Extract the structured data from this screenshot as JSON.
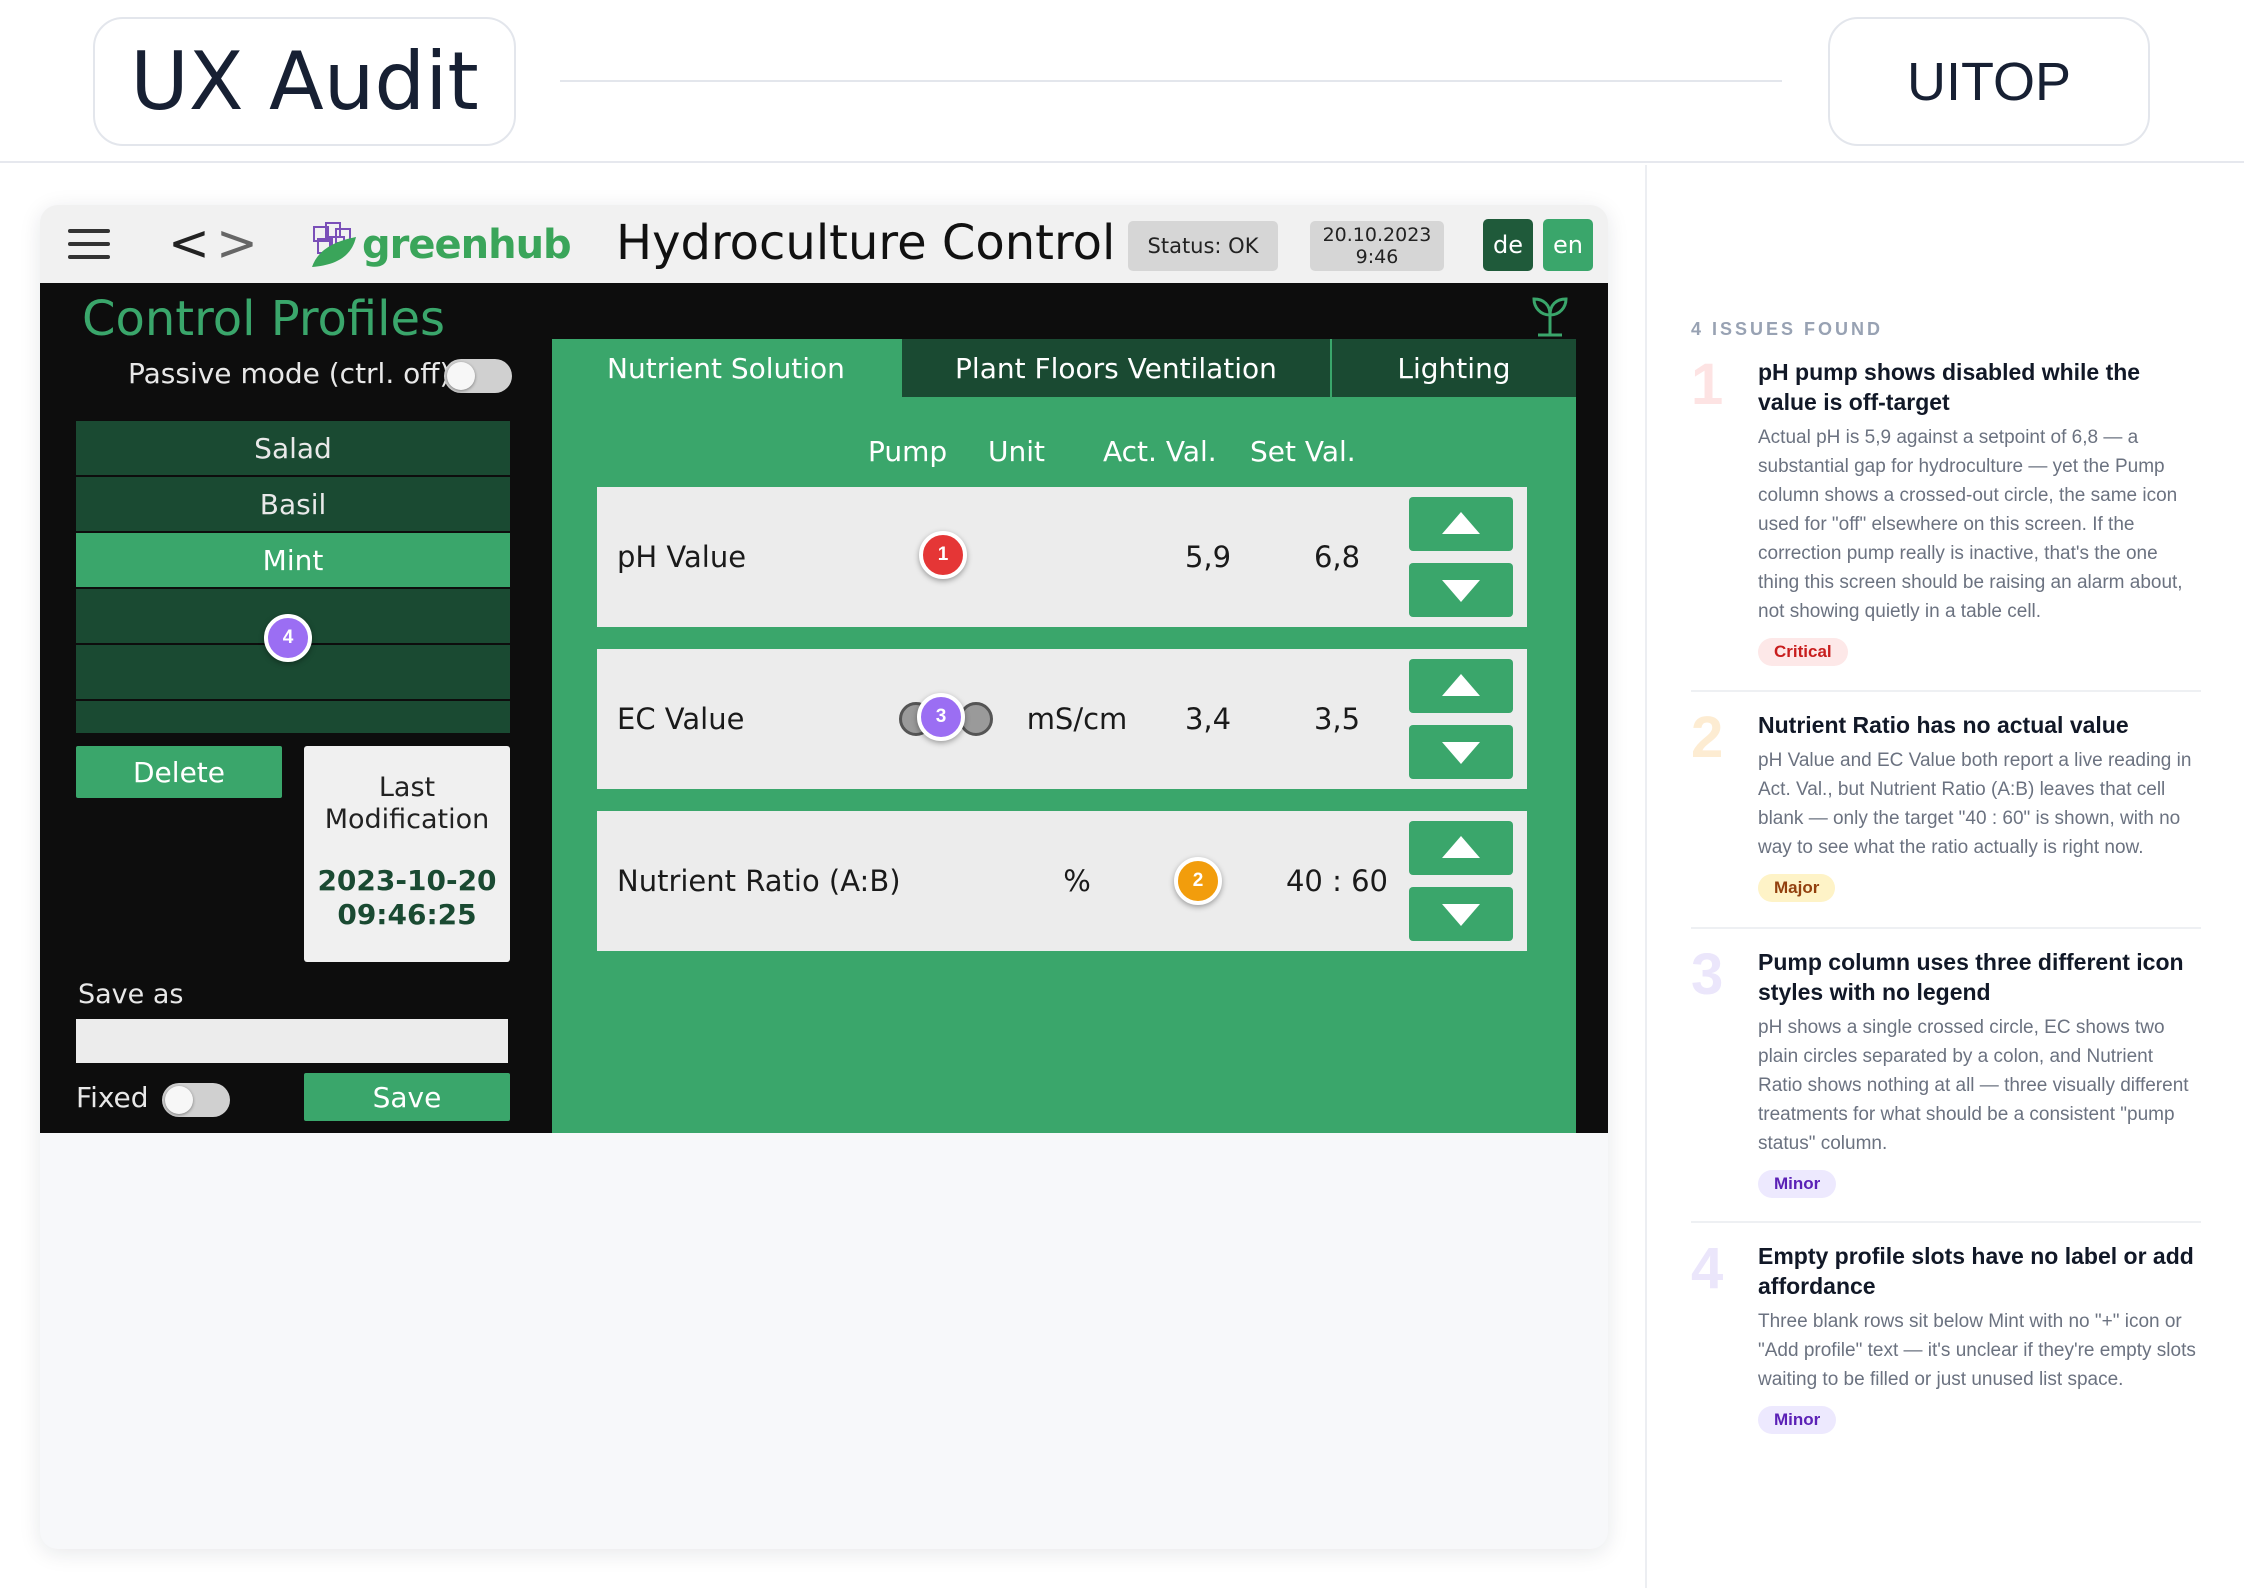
{
  "header": {
    "title": "UX Audit",
    "brand": "UITOP"
  },
  "app": {
    "brand_name": "greenhub",
    "title": "Hydroculture Control",
    "status": "Status: OK",
    "date": "20.10.2023",
    "time": "9:46",
    "lang_de": "de",
    "lang_en": "en",
    "accent_color": "#3aa66b",
    "dark_green": "#1a4a32"
  },
  "profiles": {
    "title": "Control Profiles",
    "passive_label": "Passive mode (ctrl. off)",
    "items": [
      "Salad",
      "Basil",
      "Mint",
      "",
      "",
      ""
    ],
    "active_index": 2,
    "delete_label": "Delete",
    "last_mod_label": "Last Modification",
    "last_mod_date": "2023-10-20",
    "last_mod_time": "09:46:25",
    "save_as_label": "Save as",
    "save_as_value": "",
    "fixed_label": "Fixed",
    "save_label": "Save"
  },
  "tabs": [
    "Nutrient Solution",
    "Plant Floors Ventilation",
    "Lighting"
  ],
  "table": {
    "columns": [
      "Pump",
      "Unit",
      "Act. Val.",
      "Set Val."
    ],
    "rows": [
      {
        "label": "pH Value",
        "unit": "",
        "act": "5,9",
        "set": "6,8"
      },
      {
        "label": "EC Value",
        "unit": "mS/cm",
        "act": "3,4",
        "set": "3,5"
      },
      {
        "label": "Nutrient Ratio (A:B)",
        "unit": "%",
        "act": "",
        "set": "40 : 60"
      }
    ]
  },
  "markers": [
    "1",
    "2",
    "3",
    "4"
  ],
  "sidebar": {
    "count_label": "4 ISSUES FOUND",
    "issues": [
      {
        "number": "1",
        "title": "pH pump shows disabled while the value is off-target",
        "description": "Actual pH is 5,9 against a setpoint of 6,8 — a substantial gap for hydroculture — yet the Pump column shows a crossed-out circle, the same icon used for \"off\" elsewhere on this screen. If the correction pump really is inactive, that's the one thing this screen should be raising an alarm about, not showing quietly in a table cell.",
        "severity": "Critical"
      },
      {
        "number": "2",
        "title": "Nutrient Ratio has no actual value",
        "description": "pH Value and EC Value both report a live reading in Act. Val., but Nutrient Ratio (A:B) leaves that cell blank — only the target \"40 : 60\" is shown, with no way to see what the ratio actually is right now.",
        "severity": "Major"
      },
      {
        "number": "3",
        "title": "Pump column uses three different icon styles with no legend",
        "description": "pH shows a single crossed circle, EC shows two plain circles separated by a colon, and Nutrient Ratio shows nothing at all — three visually different treatments for what should be a consistent \"pump status\" column.",
        "severity": "Minor"
      },
      {
        "number": "4",
        "title": "Empty profile slots have no label or add affordance",
        "description": "Three blank rows sit below Mint with no \"+\" icon or \"Add profile\" text — it's unclear if they're empty slots waiting to be filled or just unused list space.",
        "severity": "Minor"
      }
    ]
  }
}
